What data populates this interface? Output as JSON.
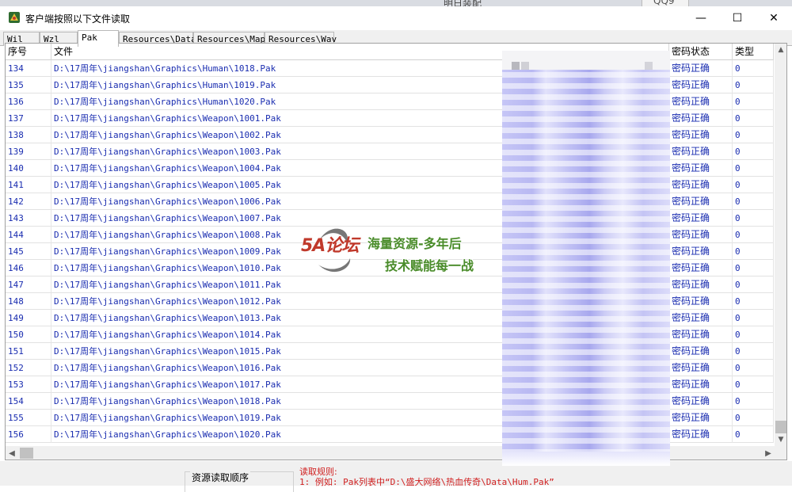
{
  "desktop": {
    "bg_text": "明日装配",
    "tab_label": "QQ9"
  },
  "window": {
    "title": "客户端按照以下文件读取",
    "minimize": "—",
    "maximize": "☐",
    "close": "✕"
  },
  "tabs": [
    {
      "label": "Wil",
      "active": false
    },
    {
      "label": "Wzl",
      "active": false
    },
    {
      "label": "Pak",
      "active": true
    },
    {
      "label": "Resources\\Data",
      "active": false
    },
    {
      "label": "Resources\\Map",
      "active": false
    },
    {
      "label": "Resources\\Wav",
      "active": false
    }
  ],
  "table": {
    "columns": [
      "序号",
      "文件",
      "密码状态",
      "类型"
    ],
    "rows": [
      {
        "idx": "134",
        "file": "D:\\17周年\\jiangshan\\Graphics\\Human\\1018.Pak",
        "status": "密码正确",
        "type": "0"
      },
      {
        "idx": "135",
        "file": "D:\\17周年\\jiangshan\\Graphics\\Human\\1019.Pak",
        "status": "密码正确",
        "type": "0"
      },
      {
        "idx": "136",
        "file": "D:\\17周年\\jiangshan\\Graphics\\Human\\1020.Pak",
        "status": "密码正确",
        "type": "0"
      },
      {
        "idx": "137",
        "file": "D:\\17周年\\jiangshan\\Graphics\\Weapon\\1001.Pak",
        "status": "密码正确",
        "type": "0"
      },
      {
        "idx": "138",
        "file": "D:\\17周年\\jiangshan\\Graphics\\Weapon\\1002.Pak",
        "status": "密码正确",
        "type": "0"
      },
      {
        "idx": "139",
        "file": "D:\\17周年\\jiangshan\\Graphics\\Weapon\\1003.Pak",
        "status": "密码正确",
        "type": "0"
      },
      {
        "idx": "140",
        "file": "D:\\17周年\\jiangshan\\Graphics\\Weapon\\1004.Pak",
        "status": "密码正确",
        "type": "0"
      },
      {
        "idx": "141",
        "file": "D:\\17周年\\jiangshan\\Graphics\\Weapon\\1005.Pak",
        "status": "密码正确",
        "type": "0"
      },
      {
        "idx": "142",
        "file": "D:\\17周年\\jiangshan\\Graphics\\Weapon\\1006.Pak",
        "status": "密码正确",
        "type": "0"
      },
      {
        "idx": "143",
        "file": "D:\\17周年\\jiangshan\\Graphics\\Weapon\\1007.Pak",
        "status": "密码正确",
        "type": "0"
      },
      {
        "idx": "144",
        "file": "D:\\17周年\\jiangshan\\Graphics\\Weapon\\1008.Pak",
        "status": "密码正确",
        "type": "0"
      },
      {
        "idx": "145",
        "file": "D:\\17周年\\jiangshan\\Graphics\\Weapon\\1009.Pak",
        "status": "密码正确",
        "type": "0"
      },
      {
        "idx": "146",
        "file": "D:\\17周年\\jiangshan\\Graphics\\Weapon\\1010.Pak",
        "status": "密码正确",
        "type": "0"
      },
      {
        "idx": "147",
        "file": "D:\\17周年\\jiangshan\\Graphics\\Weapon\\1011.Pak",
        "status": "密码正确",
        "type": "0"
      },
      {
        "idx": "148",
        "file": "D:\\17周年\\jiangshan\\Graphics\\Weapon\\1012.Pak",
        "status": "密码正确",
        "type": "0"
      },
      {
        "idx": "149",
        "file": "D:\\17周年\\jiangshan\\Graphics\\Weapon\\1013.Pak",
        "status": "密码正确",
        "type": "0"
      },
      {
        "idx": "150",
        "file": "D:\\17周年\\jiangshan\\Graphics\\Weapon\\1014.Pak",
        "status": "密码正确",
        "type": "0"
      },
      {
        "idx": "151",
        "file": "D:\\17周年\\jiangshan\\Graphics\\Weapon\\1015.Pak",
        "status": "密码正确",
        "type": "0"
      },
      {
        "idx": "152",
        "file": "D:\\17周年\\jiangshan\\Graphics\\Weapon\\1016.Pak",
        "status": "密码正确",
        "type": "0"
      },
      {
        "idx": "153",
        "file": "D:\\17周年\\jiangshan\\Graphics\\Weapon\\1017.Pak",
        "status": "密码正确",
        "type": "0"
      },
      {
        "idx": "154",
        "file": "D:\\17周年\\jiangshan\\Graphics\\Weapon\\1018.Pak",
        "status": "密码正确",
        "type": "0"
      },
      {
        "idx": "155",
        "file": "D:\\17周年\\jiangshan\\Graphics\\Weapon\\1019.Pak",
        "status": "密码正确",
        "type": "0"
      },
      {
        "idx": "156",
        "file": "D:\\17周年\\jiangshan\\Graphics\\Weapon\\1020.Pak",
        "status": "密码正确",
        "type": "0"
      }
    ]
  },
  "watermark": {
    "logo": "5A论坛",
    "line1": "海量资源-多年后",
    "line2": "技术赋能每一战"
  },
  "bottom": {
    "group_label": "资源读取顺序",
    "rules_title": "读取规则:",
    "rules_line": "1: 例如: Pak列表中“D:\\盛大网络\\热血传奇\\Data\\Hum.Pak”"
  },
  "colors": {
    "row_text": "#1a2db0",
    "rules_text": "#d02020",
    "watermark_text": "#4a8c2a",
    "watermark_logo": "#c0392b"
  },
  "icons": {
    "app": "app-icon",
    "scroll_up": "arrow-up-icon",
    "scroll_down": "arrow-down-icon",
    "scroll_left": "arrow-left-icon",
    "scroll_right": "arrow-right-icon"
  }
}
